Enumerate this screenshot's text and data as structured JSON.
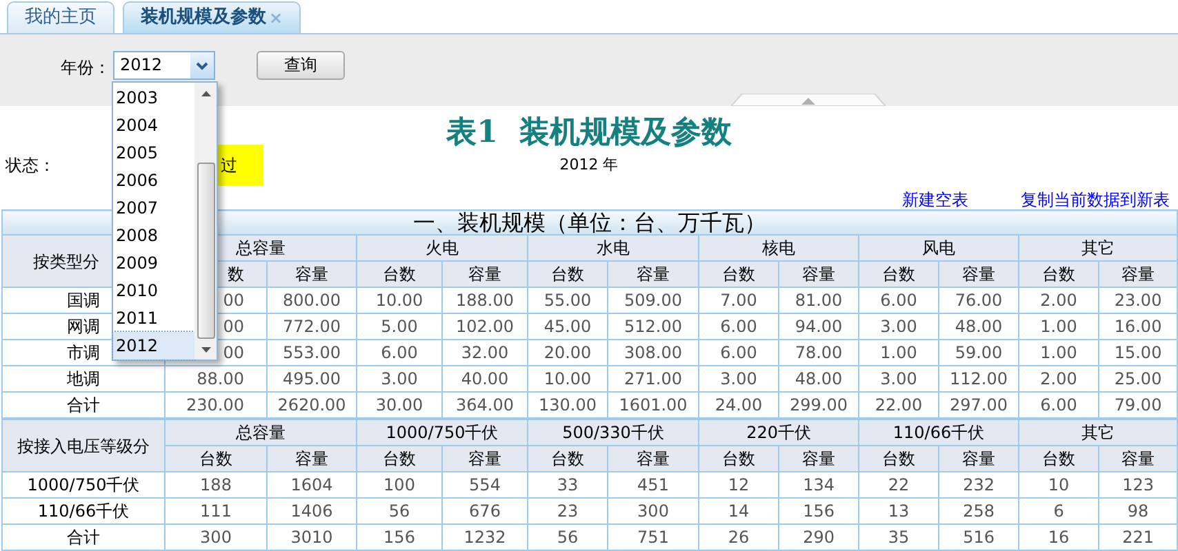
{
  "tabs": [
    {
      "label": "我的主页",
      "selected": false
    },
    {
      "label": "装机规模及参数",
      "selected": true,
      "close": "×"
    }
  ],
  "toolbar": {
    "year_label": "年份：",
    "year_value": "2012",
    "query_button": "查询"
  },
  "year_dropdown": [
    {
      "label": "2003",
      "selected": false
    },
    {
      "label": "2004",
      "selected": false
    },
    {
      "label": "2005",
      "selected": false
    },
    {
      "label": "2006",
      "selected": false
    },
    {
      "label": "2007",
      "selected": false
    },
    {
      "label": "2008",
      "selected": false
    },
    {
      "label": "2009",
      "selected": false
    },
    {
      "label": "2010",
      "selected": false
    },
    {
      "label": "2011",
      "selected": false
    },
    {
      "label": "2012",
      "selected": true
    }
  ],
  "report": {
    "title": "表1  装机规模及参数",
    "year_caption": "2012 年",
    "status_label": "状态：",
    "status_value": "过",
    "links": [
      "新建空表",
      "复制当前数据到新表"
    ]
  },
  "table1": {
    "section_title": "一、装机规模（单位：台、万千瓦）",
    "row_header": "按类型分",
    "groups": [
      {
        "label": "总容量",
        "sub_columns": [
          "数",
          "容量"
        ]
      },
      {
        "label": "火电",
        "sub_columns": [
          "台数",
          "容量"
        ]
      },
      {
        "label": "水电",
        "sub_columns": [
          "台数",
          "容量"
        ]
      },
      {
        "label": "核电",
        "sub_columns": [
          "台数",
          "容量"
        ]
      },
      {
        "label": "风电",
        "sub_columns": [
          "台数",
          "容量"
        ]
      },
      {
        "label": "其它",
        "sub_columns": [
          "台数",
          "容量"
        ]
      }
    ],
    "rows": [
      {
        "label": "国调",
        "cells": [
          "00",
          "800.00",
          "10.00",
          "188.00",
          "55.00",
          "509.00",
          "7.00",
          "81.00",
          "6.00",
          "76.00",
          "2.00",
          "23.00"
        ]
      },
      {
        "label": "网调",
        "cells": [
          "00",
          "772.00",
          "5.00",
          "102.00",
          "45.00",
          "512.00",
          "6.00",
          "94.00",
          "3.00",
          "48.00",
          "1.00",
          "16.00"
        ]
      },
      {
        "label": "市调",
        "cells": [
          "00",
          "553.00",
          "6.00",
          "32.00",
          "20.00",
          "308.00",
          "6.00",
          "78.00",
          "1.00",
          "59.00",
          "1.00",
          "15.00"
        ]
      },
      {
        "label": "地调",
        "cells": [
          "88.00",
          "495.00",
          "3.00",
          "40.00",
          "10.00",
          "271.00",
          "3.00",
          "48.00",
          "3.00",
          "112.00",
          "2.00",
          "25.00"
        ]
      },
      {
        "label": "合计",
        "cells": [
          "230.00",
          "2620.00",
          "30.00",
          "364.00",
          "130.00",
          "1601.00",
          "24.00",
          "299.00",
          "22.00",
          "297.00",
          "6.00",
          "79.00"
        ]
      }
    ]
  },
  "table2": {
    "row_header": "按接入电压等级分",
    "groups": [
      {
        "label": "总容量",
        "sub_columns": [
          "台数",
          "容量"
        ]
      },
      {
        "label": "1000/750千伏",
        "sub_columns": [
          "台数",
          "容量"
        ]
      },
      {
        "label": "500/330千伏",
        "sub_columns": [
          "台数",
          "容量"
        ]
      },
      {
        "label": "220千伏",
        "sub_columns": [
          "台数",
          "容量"
        ]
      },
      {
        "label": "110/66千伏",
        "sub_columns": [
          "台数",
          "容量"
        ]
      },
      {
        "label": "其它",
        "sub_columns": [
          "台数",
          "容量"
        ]
      }
    ],
    "rows": [
      {
        "label": "1000/750千伏",
        "cells": [
          "188",
          "1604",
          "100",
          "554",
          "33",
          "451",
          "12",
          "134",
          "22",
          "232",
          "10",
          "123"
        ]
      },
      {
        "label": "110/66千伏",
        "cells": [
          "111",
          "1406",
          "56",
          "676",
          "23",
          "300",
          "14",
          "156",
          "13",
          "258",
          "6",
          "98"
        ]
      },
      {
        "label": "合计",
        "cells": [
          "300",
          "3010",
          "156",
          "1232",
          "56",
          "751",
          "26",
          "290",
          "35",
          "516",
          "16",
          "221"
        ]
      }
    ]
  }
}
